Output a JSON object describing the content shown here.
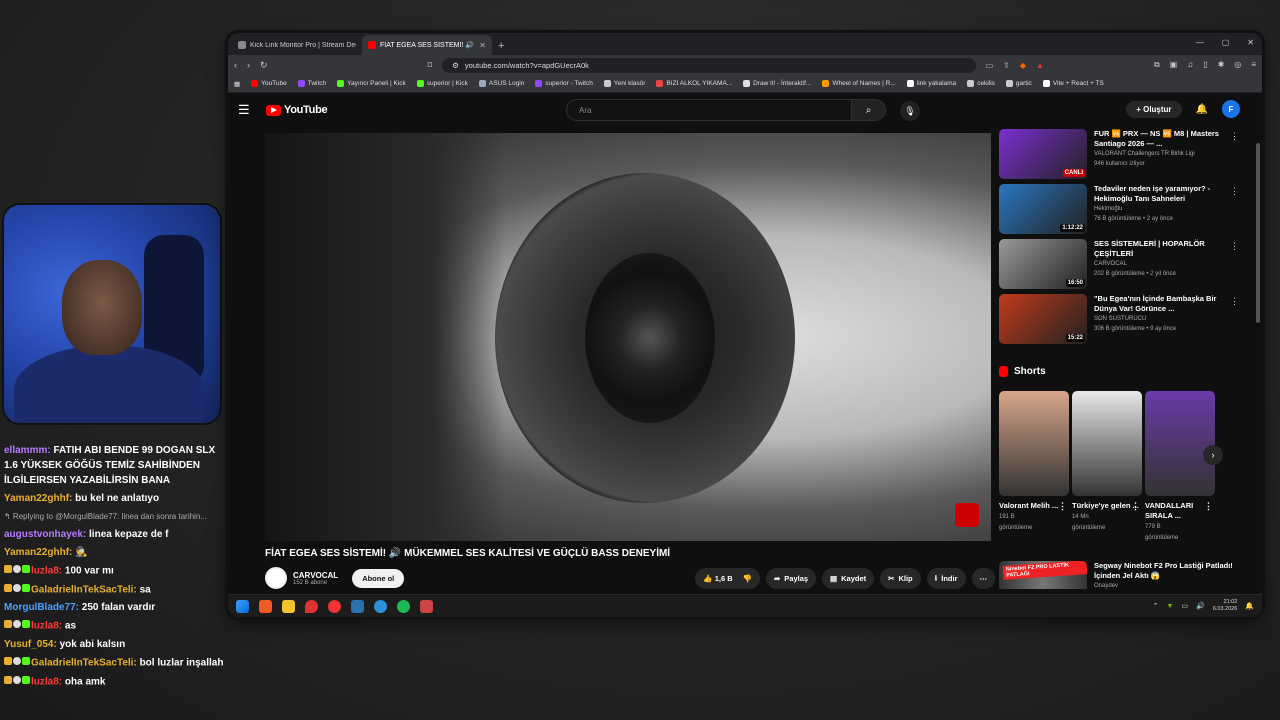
{
  "browser": {
    "tabs": [
      {
        "label": "Kick Link Monitor Pro | Stream Deck"
      },
      {
        "label": "FİAT EGEA SES SİSTEMİ! 🔊 M"
      }
    ],
    "url": "youtube.com/watch?v=apdGUecrA0k",
    "bookmarks": [
      "YouTube",
      "Twitch",
      "Yayıncı Paneli | Kick",
      "superior | Kick",
      "ASUS Login",
      "superior - Twitch",
      "Yeni klasör",
      "BIZI ALKOL YIKAMA...",
      "Draw it! - İnteraktif...",
      "Wheel of Names | R...",
      "link yakalama",
      "cekilis",
      "gartic",
      "Vite + React + TS"
    ],
    "window_controls": [
      "—",
      "▢",
      "✕"
    ]
  },
  "youtube": {
    "logo_text": "YouTube",
    "search_placeholder": "Ara",
    "create_label": "Oluştur",
    "avatar_letter": "F",
    "video_title": "FİAT EGEA SES SİSTEMİ! 🔊 MÜKEMMEL SES KALİTESİ VE GÜÇLÜ BASS DENEYİMİ",
    "channel": {
      "name": "CARVOCAL",
      "subs": "152 B abone",
      "subscribe_label": "Abone ol"
    },
    "actions": {
      "likes": "1,6 B",
      "share": "Paylaş",
      "save": "Kaydet",
      "clip": "Klip",
      "download": "İndir",
      "more": "⋯"
    },
    "recommendations": [
      {
        "title": "FUR 🆚 PRX — NS 🆚 M8 | Masters Santiago 2026 — ...",
        "channel": "VALORANT Challengers TR Birlik Ligi",
        "meta": "946 kullanıcı izliyor",
        "badge": "CANLI",
        "thumb_color": "#7a2fd0"
      },
      {
        "title": "Tedaviler neden işe yaramıyor? - Hekimoğlu Tanı Sahneleri",
        "channel": "Hekimoğlu",
        "meta": "76 B görüntüleme • 2 ay önce",
        "badge": "1:12:22",
        "thumb_color": "#2a76c0"
      },
      {
        "title": "SES SİSTEMLERİ | HOPARLÖR ÇEŞİTLERİ",
        "channel": "CARVOCAL",
        "meta": "202 B görüntüleme • 2 yıl önce",
        "badge": "16:50",
        "thumb_color": "#9a9a9a"
      },
      {
        "title": "\"Bu Egea'nın İçinde Bambaşka Bir Dünya Var! Görünce ...",
        "channel": "SON SUSTURUCU",
        "meta": "306 B görüntüleme • 9 ay önce",
        "badge": "15:22",
        "thumb_color": "#c23a1a"
      }
    ],
    "shorts_label": "Shorts",
    "shorts": [
      {
        "title": "Valorant Melih ...",
        "meta1": "191 B",
        "meta2": "görüntüleme",
        "thumb_color": "#d8a58a"
      },
      {
        "title": "Türkiye'ye gelen ...",
        "meta1": "14 Mn",
        "meta2": "görüntüleme",
        "thumb_color": "#e8e8e8"
      },
      {
        "title": "VANDALLARI SIRALA ...",
        "meta1": "779 B",
        "meta2": "görüntüleme",
        "thumb_color": "#6a3aa8"
      }
    ],
    "ad": {
      "badge": "Ninebot F2 PRO LASTİK PATLAĞI",
      "title": "Segway Ninebot F2 Pro Lastiği Patladı! İçinden Jel Aktı 😱",
      "channel": "Onaydev"
    }
  },
  "taskbar": {
    "time": "21:02",
    "date": "6.03.2026"
  },
  "chat": [
    {
      "user": "ellammm:",
      "user_color": "#b97aff",
      "text": "FATIH ABI BENDE 99 DOGAN SLX 1.6 YÜKSEK GÖĞÜS TEMİZ SAHİBİNDEN İLGİLEIRSEN YAZABİLİRSİN BANA",
      "badges": false,
      "wrap": true
    },
    {
      "user": "Yaman22ghhf:",
      "user_color": "#e8b030",
      "text": "bu kel ne anlatıyo",
      "badges": false
    },
    {
      "reply": "↰ Replying to @MorgulBlade77: linea dan sonra tarihin..."
    },
    {
      "user": "augustvonhayek:",
      "user_color": "#b97aff",
      "text": "linea kepaze de f",
      "badges": false
    },
    {
      "user": "Yaman22ghhf:",
      "user_color": "#e8b030",
      "text": "🕵",
      "badges": false
    },
    {
      "user": "luzla8:",
      "user_color": "#ff3b3b",
      "text": "100 var mı",
      "badges": true
    },
    {
      "user": "GaladrielInTekSacTeli:",
      "user_color": "#e8b030",
      "text": "sa",
      "badges": true
    },
    {
      "user": "MorgulBlade77:",
      "user_color": "#4d9fff",
      "text": "250 falan vardır",
      "badges": false
    },
    {
      "user": "luzla8:",
      "user_color": "#ff3b3b",
      "text": "as",
      "badges": true
    },
    {
      "user": "Yusuf_054:",
      "user_color": "#e8b030",
      "text": "yok abi kalsın",
      "badges": false
    },
    {
      "user": "GaladrielInTekSacTeli:",
      "user_color": "#e8b030",
      "text": "bol luzlar inşallah",
      "badges": true
    },
    {
      "user": "luzla8:",
      "user_color": "#ff3b3b",
      "text": "oha amk",
      "badges": true
    }
  ]
}
